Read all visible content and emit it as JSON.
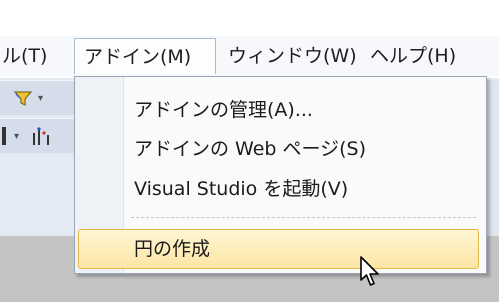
{
  "menubar": {
    "items": [
      {
        "label": "ル(T)"
      },
      {
        "label": "アドイン(M)"
      },
      {
        "label": "ウィンドウ(W)"
      },
      {
        "label": "ヘルプ(H)"
      }
    ]
  },
  "addin_menu": {
    "items": [
      {
        "label": "アドインの管理(A)..."
      },
      {
        "label": "アドインの Web ページ(S)"
      },
      {
        "label": "Visual Studio を起動(V)"
      },
      {
        "label": "円の作成"
      }
    ],
    "highlighted_index": 3
  },
  "toolbar": {
    "icons": [
      "filter-icon",
      "chart-icon"
    ]
  },
  "colors": {
    "highlight_border": "#e2b84c",
    "highlight_fill": "#fbe6a5",
    "menubar_bg": "#f6f8fb",
    "toolbar_bg": "#e4eaf3"
  }
}
